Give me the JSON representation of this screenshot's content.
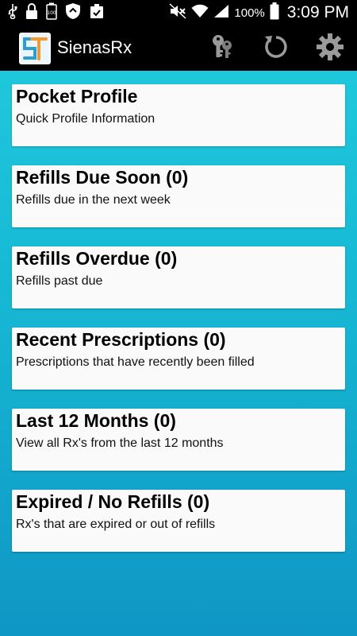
{
  "status_bar": {
    "battery_percent": "100%",
    "time": "3:09 PM",
    "left_icons": [
      "usb-icon",
      "lock-icon",
      "battery-saver-icon",
      "shield-icon",
      "clipboard-check-icon"
    ],
    "right_icons": [
      "mute-icon",
      "wifi-icon",
      "signal-icon",
      "battery-icon"
    ]
  },
  "app_bar": {
    "title": "SienasRx",
    "logo_text": "ST",
    "actions": [
      "keys-icon",
      "refresh-icon",
      "settings-icon"
    ]
  },
  "cards": [
    {
      "title": "Pocket Profile",
      "subtitle": "Quick Profile Information"
    },
    {
      "title": "Refills Due Soon (0)",
      "subtitle": "Refills due in the next week"
    },
    {
      "title": "Refills Overdue (0)",
      "subtitle": "Refills past due"
    },
    {
      "title": "Recent Prescriptions (0)",
      "subtitle": "Prescriptions that have recently been filled"
    },
    {
      "title": "Last 12 Months (0)",
      "subtitle": "View all Rx's from the last 12 months"
    },
    {
      "title": "Expired / No Refills (0)",
      "subtitle": "Rx's that are expired or out of refills"
    }
  ],
  "colors": {
    "background_top": "#1fc7dc",
    "background_bottom": "#0f96c4",
    "card": "#fafafa",
    "bar": "#000000"
  }
}
